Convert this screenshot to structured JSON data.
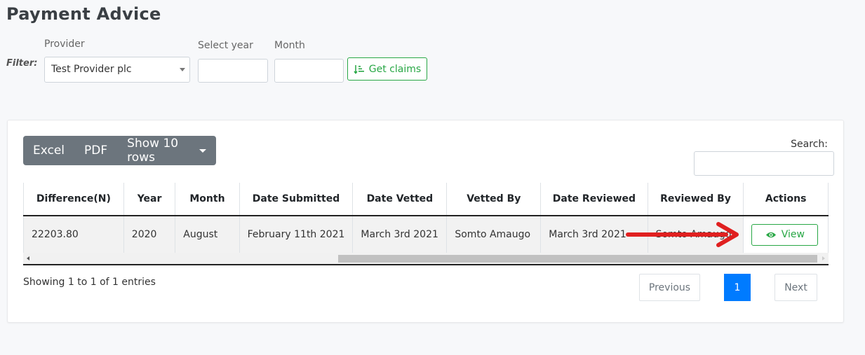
{
  "page": {
    "title": "Payment Advice"
  },
  "filter": {
    "label": "Filter:",
    "provider_label": "Provider",
    "provider_value": "Test Provider plc",
    "year_label": "Select year",
    "year_value": "",
    "month_label": "Month",
    "month_value": "",
    "get_claims_label": "Get claims"
  },
  "toolbar": {
    "excel_label": "Excel",
    "pdf_label": "PDF",
    "rows_label": "Show 10 rows",
    "search_label": "Search:",
    "search_value": ""
  },
  "table": {
    "headers": [
      "Difference(N)",
      "Year",
      "Month",
      "Date Submitted",
      "Date Vetted",
      "Vetted By",
      "Date Reviewed",
      "Reviewed By",
      "Actions"
    ],
    "rows": [
      {
        "difference": "22203.80",
        "year": "2020",
        "month": "August",
        "date_submitted": "February 11th 2021",
        "date_vetted": "March 3rd 2021",
        "vetted_by": "Somto Amaugo",
        "date_reviewed": "March 3rd 2021",
        "reviewed_by": "Somto Amaugo",
        "action_label": "View"
      }
    ]
  },
  "footer": {
    "info": "Showing 1 to 1 of 1 entries",
    "previous_label": "Previous",
    "page_number": "1",
    "next_label": "Next"
  },
  "annotation": {
    "arrow_color": "#e02020"
  },
  "colors": {
    "success": "#28a745",
    "primary": "#007bff",
    "secondary": "#6c757d"
  }
}
